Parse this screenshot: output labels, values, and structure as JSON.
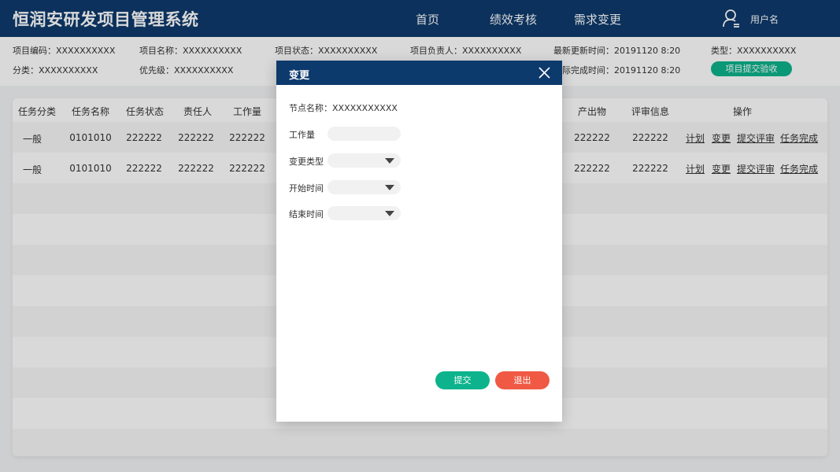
{
  "header": {
    "app_title": "恒润安研发项目管理系统",
    "nav": [
      "首页",
      "绩效考核",
      "需求变更"
    ],
    "user_name": "用户名"
  },
  "info": {
    "row1": {
      "code": "项目编码：XXXXXXXXXX",
      "name": "项目名称：XXXXXXXXXX",
      "status": "项目状态：XXXXXXXXXX",
      "owner": "项目负责人：XXXXXXXXXX",
      "updated": "最新更新时间：20191120 8:20",
      "type": "类型：XXXXXXXXXX"
    },
    "row2": {
      "category": "分类：XXXXXXXXXX",
      "priority": "优先级：XXXXXXXXXX",
      "completed": "际完成时间：20191120 8:20"
    },
    "accept_button": "项目提交验收"
  },
  "table": {
    "headers": {
      "category": "任务分类",
      "name": "任务名称",
      "status": "任务状态",
      "owner": "责任人",
      "workload": "工作量",
      "output": "产出物",
      "review": "评审信息",
      "actions": "操作"
    },
    "rows": [
      {
        "category": "一般",
        "name": "0101010",
        "status": "222222",
        "owner": "222222",
        "workload": "222222",
        "output": "222222",
        "review": "222222"
      },
      {
        "category": "一般",
        "name": "0101010",
        "status": "222222",
        "owner": "222222",
        "workload": "222222",
        "output": "222222",
        "review": "222222"
      }
    ],
    "actions": {
      "plan": "计划",
      "change": "变更",
      "submit_review": "提交评审",
      "complete": "任务完成"
    }
  },
  "modal": {
    "title": "变更",
    "node_name": "节点名称：XXXXXXXXXXX",
    "workload_label": "工作量",
    "workload_value": "",
    "change_type_label": "变更类型",
    "start_time_label": "开始时间",
    "end_time_label": "结束时间",
    "submit_label": "提交",
    "exit_label": "退出"
  },
  "colors": {
    "primary": "#0d3a6d",
    "success": "#0db38c",
    "danger": "#f05a44"
  }
}
